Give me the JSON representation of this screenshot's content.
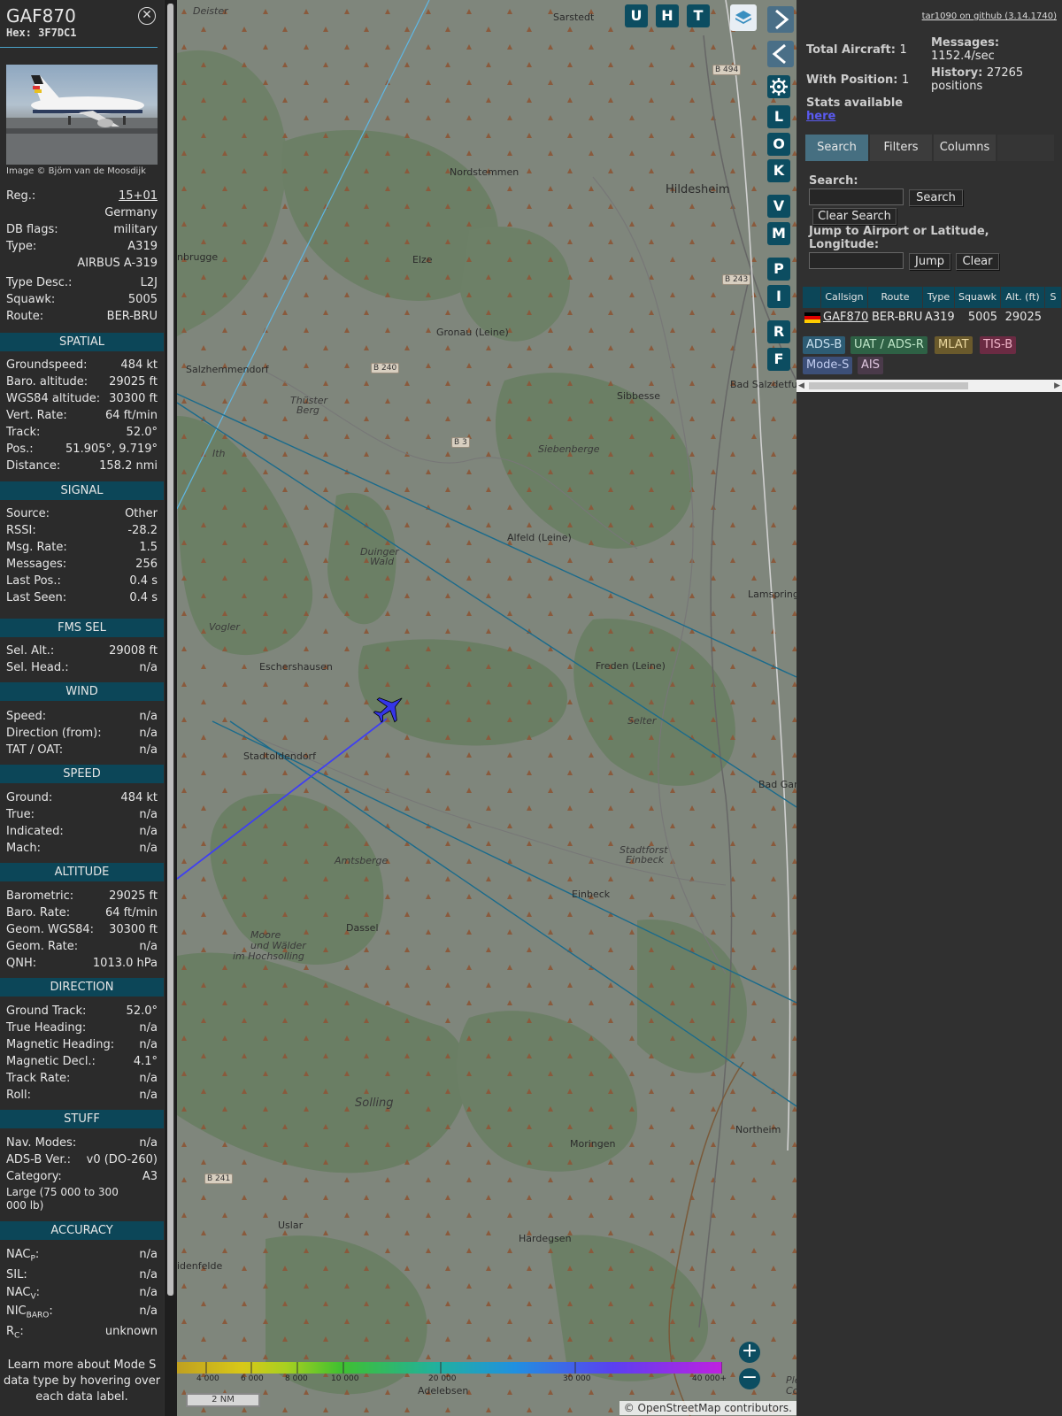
{
  "aircraft": {
    "callsign": "GAF870",
    "hex_label": "Hex:",
    "hex": "3F7DC1",
    "photo_credit": "Image © Björn van de Moosdijk",
    "reg_label": "Reg.:",
    "reg": "15+01",
    "country": "Germany",
    "dbflags_label": "DB flags:",
    "dbflags": "military",
    "type_label": "Type:",
    "type": "A319",
    "type_name": "AIRBUS A-319",
    "typedesc_label": "Type Desc.:",
    "typedesc": "L2J",
    "squawk_label": "Squawk:",
    "squawk": "5005",
    "route_label": "Route:",
    "route": "BER-BRU"
  },
  "sections": {
    "spatial": "SPATIAL",
    "signal": "SIGNAL",
    "fms": "FMS SEL",
    "wind": "WIND",
    "speed": "SPEED",
    "altitude": "ALTITUDE",
    "direction": "DIRECTION",
    "stuff": "STUFF",
    "accuracy": "ACCURACY"
  },
  "spatial": [
    [
      "Groundspeed:",
      "484 kt"
    ],
    [
      "Baro. altitude:",
      "29025 ft"
    ],
    [
      "WGS84 altitude:",
      "30300 ft"
    ],
    [
      "Vert. Rate:",
      "64 ft/min"
    ],
    [
      "Track:",
      "52.0°"
    ],
    [
      "Pos.:",
      "51.905°, 9.719°"
    ],
    [
      "Distance:",
      "158.2 nmi"
    ]
  ],
  "signal": [
    [
      "Source:",
      "Other"
    ],
    [
      "RSSI:",
      "-28.2"
    ],
    [
      "Msg. Rate:",
      "1.5"
    ],
    [
      "Messages:",
      "256"
    ],
    [
      "Last Pos.:",
      "0.4 s"
    ],
    [
      "Last Seen:",
      "0.4 s"
    ]
  ],
  "fms": [
    [
      "Sel. Alt.:",
      "29008 ft"
    ],
    [
      "Sel. Head.:",
      "n/a"
    ]
  ],
  "wind": [
    [
      "Speed:",
      "n/a"
    ],
    [
      "Direction (from):",
      "n/a"
    ],
    [
      "TAT / OAT:",
      "n/a"
    ]
  ],
  "speed": [
    [
      "Ground:",
      "484 kt"
    ],
    [
      "True:",
      "n/a"
    ],
    [
      "Indicated:",
      "n/a"
    ],
    [
      "Mach:",
      "n/a"
    ]
  ],
  "altitude": [
    [
      "Barometric:",
      "29025 ft"
    ],
    [
      "Baro. Rate:",
      "64 ft/min"
    ],
    [
      "Geom. WGS84:",
      "30300 ft"
    ],
    [
      "Geom. Rate:",
      "n/a"
    ],
    [
      "QNH:",
      "1013.0 hPa"
    ]
  ],
  "direction": [
    [
      "Ground Track:",
      "52.0°"
    ],
    [
      "True Heading:",
      "n/a"
    ],
    [
      "Magnetic Heading:",
      "n/a"
    ],
    [
      "Magnetic Decl.:",
      "4.1°"
    ],
    [
      "Track Rate:",
      "n/a"
    ],
    [
      "Roll:",
      "n/a"
    ]
  ],
  "stuff": {
    "rows": [
      [
        "Nav. Modes:",
        "n/a"
      ],
      [
        "ADS-B Ver.:",
        "v0 (DO-260)"
      ],
      [
        "Category:",
        "A3"
      ]
    ],
    "category_desc": "Large (75 000 to 300 000 lb)"
  },
  "accuracy": {
    "nacp_label": "NAC",
    "nacp_sub": "P",
    "nacp": "n/a",
    "sil_label": "SIL:",
    "sil": "n/a",
    "nacv_label": "NAC",
    "nacv_sub": "V",
    "nacv": "n/a",
    "nicbaro_label": "NIC",
    "nicbaro_sub": "BARO",
    "nicbaro": "n/a",
    "rc_label": "R",
    "rc_sub": "C",
    "rc": "unknown"
  },
  "learn_more": "Learn more about Mode S data type by hovering over each data label.",
  "map": {
    "buttons": [
      "U",
      "H",
      "T"
    ],
    "side_buttons": [
      "L",
      "O",
      "K",
      "V",
      "M",
      "P",
      "I",
      "R",
      "F"
    ],
    "places": [
      [
        "Deister",
        218,
        6,
        "it"
      ],
      [
        "Sarstedt",
        625,
        13,
        ""
      ],
      [
        "Nordstemmen",
        508,
        188,
        ""
      ],
      [
        "Hildesheim",
        752,
        207,
        "big"
      ],
      [
        "nbrugge",
        200,
        284,
        ""
      ],
      [
        "Elze",
        466,
        287,
        ""
      ],
      [
        "Gronau (Leine)",
        493,
        369,
        ""
      ],
      [
        "Salzhemmendorf",
        210,
        411,
        ""
      ],
      [
        "Thüster",
        328,
        446,
        "it"
      ],
      [
        "Berg",
        335,
        457,
        "it"
      ],
      [
        "Sibbesse",
        697,
        441,
        ""
      ],
      [
        "Bad Salzdetfurt",
        825,
        428,
        ""
      ],
      [
        "Siebenberge",
        608,
        501,
        "it"
      ],
      [
        "Ith",
        240,
        506,
        "it"
      ],
      [
        "Alfeld (Leine)",
        573,
        601,
        ""
      ],
      [
        "Duinger",
        407,
        617,
        "it"
      ],
      [
        "Wald",
        418,
        628,
        "it"
      ],
      [
        "Vogler",
        236,
        702,
        "it"
      ],
      [
        "Lamspringe",
        845,
        665,
        ""
      ],
      [
        "Eschershausen",
        293,
        747,
        ""
      ],
      [
        "Freden (Leine)",
        673,
        746,
        ""
      ],
      [
        "Selter",
        709,
        808,
        "it"
      ],
      [
        "Stadtoldendorf",
        275,
        848,
        ""
      ],
      [
        "Bad Gan",
        857,
        880,
        ""
      ],
      [
        "Stadtforst",
        700,
        954,
        "it"
      ],
      [
        "Einbeck",
        707,
        965,
        "it"
      ],
      [
        "Amtsberge",
        378,
        966,
        "it"
      ],
      [
        "Einbeck",
        646,
        1004,
        ""
      ],
      [
        "Dassel",
        391,
        1042,
        ""
      ],
      [
        "Moore",
        283,
        1050,
        "it"
      ],
      [
        "und Wälder",
        283,
        1062,
        "it"
      ],
      [
        "im Hochsolling",
        263,
        1074,
        "it"
      ],
      [
        "Solling",
        401,
        1239,
        "it big"
      ],
      [
        "Moringen",
        644,
        1286,
        ""
      ],
      [
        "Northeim",
        831,
        1270,
        ""
      ],
      [
        "Uslar",
        314,
        1378,
        ""
      ],
      [
        "Hardegsen",
        586,
        1393,
        ""
      ],
      [
        "idenfelde",
        200,
        1424,
        ""
      ],
      [
        "Adelebsen",
        472,
        1565,
        ""
      ],
      [
        "Ple",
        888,
        1553,
        "it"
      ],
      [
        "Cor",
        888,
        1565,
        "it"
      ]
    ],
    "roads": [
      [
        "B 494",
        805,
        73
      ],
      [
        "B 243",
        816,
        310
      ],
      [
        "B 240",
        419,
        410
      ],
      [
        "B 3",
        510,
        494
      ],
      [
        "B 241",
        231,
        1326
      ]
    ],
    "legend_ticks": [
      "4 000",
      "6 000",
      "8 000",
      "10 000",
      "20 000",
      "30 000",
      "40 000+"
    ],
    "scale": "2 NM",
    "attribution": "© OpenStreetMap contributors."
  },
  "panel": {
    "github": "tar1090 on github (3.14.1740)",
    "total_label": "Total Aircraft:",
    "total": "1",
    "withpos_label": "With Position:",
    "withpos": "1",
    "stats_label": "Stats available",
    "stats_link": "here",
    "messages_label": "Messages:",
    "messages": "1152.4/sec",
    "history_label": "History:",
    "history": "27265 positions",
    "tabs": [
      "Search",
      "Filters",
      "Columns"
    ],
    "search_label": "Search:",
    "search_btn": "Search",
    "clear_search_btn": "Clear Search",
    "jump_label": "Jump to Airport or Latitude, Longitude:",
    "jump_btn": "Jump",
    "clear_btn": "Clear",
    "columns": [
      "",
      "Callsign",
      "Route",
      "Type",
      "Squawk",
      "Alt. (ft)",
      "S"
    ],
    "row": {
      "callsign": "GAF870",
      "route": "BER-BRU",
      "type": "A319",
      "squawk": "5005",
      "alt": "29025"
    },
    "sources": [
      [
        "ADS-B",
        "#2d5c74",
        "#c8e0ee"
      ],
      [
        "UAT / ADS-R",
        "#2e6145",
        "#bfe6c8"
      ],
      [
        "MLAT",
        "#6a5a2c",
        "#ecd9a0"
      ],
      [
        "TIS-B",
        "#6b2b43",
        "#f0b5c8"
      ],
      [
        "Mode-S",
        "#3c4f78",
        "#c2cdf0"
      ],
      [
        "AIS",
        "#4a3a4a",
        "#e0c8e0"
      ]
    ]
  }
}
